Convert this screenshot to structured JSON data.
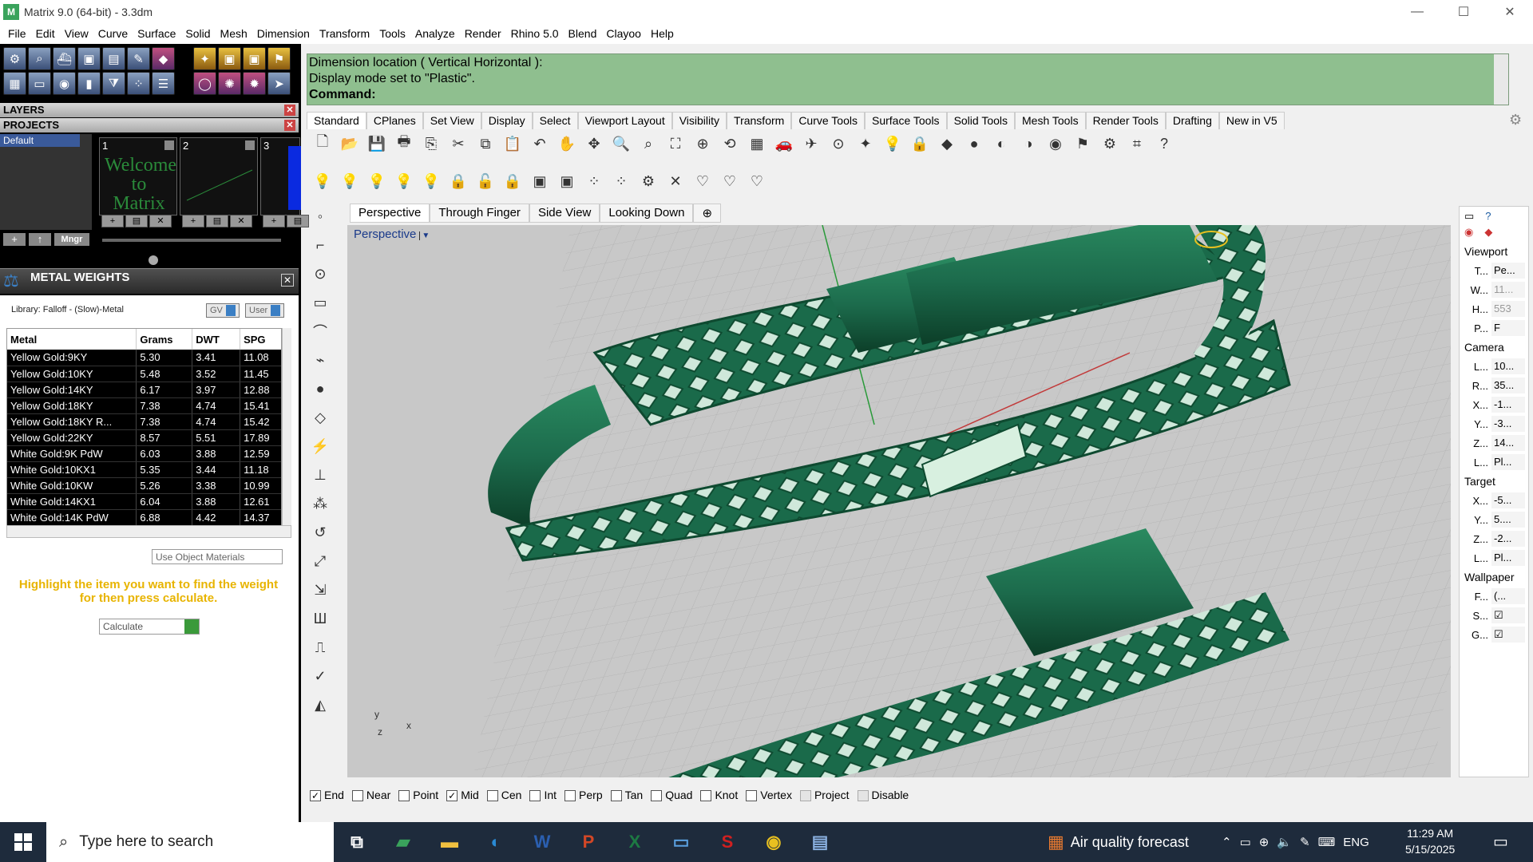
{
  "window": {
    "title": "Matrix 9.0 (64-bit) - 3.3dm",
    "min": "—",
    "max": "☐",
    "close": "✕",
    "logo": "M"
  },
  "menu": [
    "File",
    "Edit",
    "View",
    "Curve",
    "Surface",
    "Solid",
    "Mesh",
    "Dimension",
    "Transform",
    "Tools",
    "Analyze",
    "Render",
    "Rhino 5.0",
    "Blend",
    "Clayoo",
    "Help"
  ],
  "panels": {
    "layers": "LAYERS",
    "projects": "PROJECTS",
    "close": "✕",
    "default_layer": "Default",
    "thumbs": [
      {
        "num": "1",
        "text": "Welcome to Matrix"
      },
      {
        "num": "2",
        "text": ""
      },
      {
        "num": "3",
        "text": ""
      }
    ],
    "thumb_btns": [
      "+",
      "▤",
      "✕",
      "+",
      "▤",
      "✕",
      "+",
      "▤"
    ],
    "mngr": "Mngr"
  },
  "metal_weights": {
    "title": "METAL WEIGHTS",
    "library": "Library: Falloff - (Slow)-Metal",
    "gv": "GV",
    "user": "User",
    "columns": [
      "Metal",
      "Grams",
      "DWT",
      "SPG"
    ],
    "rows": [
      [
        "Yellow Gold:9KY",
        "5.30",
        "3.41",
        "11.08"
      ],
      [
        "Yellow Gold:10KY",
        "5.48",
        "3.52",
        "11.45"
      ],
      [
        "Yellow Gold:14KY",
        "6.17",
        "3.97",
        "12.88"
      ],
      [
        "Yellow Gold:18KY",
        "7.38",
        "4.74",
        "15.41"
      ],
      [
        "Yellow Gold:18KY R...",
        "7.38",
        "4.74",
        "15.42"
      ],
      [
        "Yellow Gold:22KY",
        "8.57",
        "5.51",
        "17.89"
      ],
      [
        "White Gold:9K PdW",
        "6.03",
        "3.88",
        "12.59"
      ],
      [
        "White Gold:10KX1",
        "5.35",
        "3.44",
        "11.18"
      ],
      [
        "White Gold:10KW",
        "5.26",
        "3.38",
        "10.99"
      ],
      [
        "White Gold:14KX1",
        "6.04",
        "3.88",
        "12.61"
      ],
      [
        "White Gold:14K PdW",
        "6.88",
        "4.42",
        "14.37"
      ]
    ],
    "use_object": "Use Object Materials",
    "hint": "Highlight the item you want to find the weight for then press calculate.",
    "calculate": "Calculate"
  },
  "command": {
    "line1": "Dimension location ( Vertical  Horizontal ):",
    "line2": "Display mode set to \"Plastic\".",
    "prompt": "Command:"
  },
  "tabs": [
    "Standard",
    "CPlanes",
    "Set View",
    "Display",
    "Select",
    "Viewport Layout",
    "Visibility",
    "Transform",
    "Curve Tools",
    "Surface Tools",
    "Solid Tools",
    "Mesh Tools",
    "Render Tools",
    "Drafting",
    "New in V5"
  ],
  "toolbar1": [
    "🗋",
    "📂",
    "💾",
    "🖶",
    "⎘",
    "✂",
    "⧉",
    "📋",
    "↶",
    "✋",
    "✥",
    "🔍",
    "⌕",
    "⛶",
    "⊕",
    "⟲",
    "▦",
    "🚗",
    "✈",
    "⊙",
    "✦",
    "💡",
    "🔒",
    "◆",
    "●",
    "◐",
    "◑",
    "◉",
    "⚑",
    "⚙",
    "⌗",
    "?"
  ],
  "toolbar2": [
    "💡",
    "💡",
    "💡",
    "💡",
    "💡",
    "🔒",
    "🔓",
    "🔒",
    "▣",
    "▣",
    "⁘",
    "⁘",
    "⚙",
    "✕",
    "♡",
    "♡",
    "♡"
  ],
  "lefttools": [
    "◦",
    "⌐",
    "⊙",
    "▭",
    "⌒",
    "⌁",
    "●",
    "◇",
    "⚡",
    "⊥",
    "⁂",
    "↺",
    "⤢",
    "⇲",
    "Ш",
    "⎍",
    "✓",
    "◭"
  ],
  "viewport_tabs": [
    "Perspective",
    "Through Finger",
    "Side View",
    "Looking Down",
    "⊕"
  ],
  "viewport": {
    "label": "Perspective",
    "dd": "▼",
    "axis_x": "x",
    "axis_y": "y",
    "axis_z": "z"
  },
  "snaps": [
    {
      "label": "End",
      "checked": true
    },
    {
      "label": "Near",
      "checked": false
    },
    {
      "label": "Point",
      "checked": false
    },
    {
      "label": "Mid",
      "checked": true
    },
    {
      "label": "Cen",
      "checked": false
    },
    {
      "label": "Int",
      "checked": false
    },
    {
      "label": "Perp",
      "checked": false
    },
    {
      "label": "Tan",
      "checked": false
    },
    {
      "label": "Quad",
      "checked": false
    },
    {
      "label": "Knot",
      "checked": false
    },
    {
      "label": "Vertex",
      "checked": false
    },
    {
      "label": "Project",
      "checked": false
    },
    {
      "label": "Disable",
      "checked": false
    }
  ],
  "right": {
    "viewport": "Viewport",
    "vp_rows": [
      [
        "T...",
        "Pe..."
      ],
      [
        "W...",
        "11..."
      ],
      [
        "H...",
        "553"
      ],
      [
        "P...",
        "F"
      ]
    ],
    "camera": "Camera",
    "cam_rows": [
      [
        "L...",
        "10..."
      ],
      [
        "R...",
        "35..."
      ],
      [
        "X...",
        "-1..."
      ],
      [
        "Y...",
        "-3..."
      ],
      [
        "Z...",
        "14..."
      ],
      [
        "L...",
        "Pl..."
      ]
    ],
    "target": "Target",
    "tgt_rows": [
      [
        "X...",
        "-5..."
      ],
      [
        "Y...",
        "5...."
      ],
      [
        "Z...",
        "-2..."
      ],
      [
        "L...",
        "Pl..."
      ]
    ],
    "wallpaper": "Wallpaper",
    "wp_rows": [
      [
        "F...",
        "(..."
      ],
      [
        "S...",
        "☑"
      ],
      [
        "G...",
        "☑"
      ]
    ]
  },
  "taskbar": {
    "search": "Type here to search",
    "weather": "Air quality forecast",
    "lang": "ENG",
    "time": "11:29 AM",
    "date": "5/15/2025"
  },
  "colors": {
    "command_bg": "#8fbf8f",
    "ring": "#1e6b4c",
    "hint": "#e8b400"
  }
}
